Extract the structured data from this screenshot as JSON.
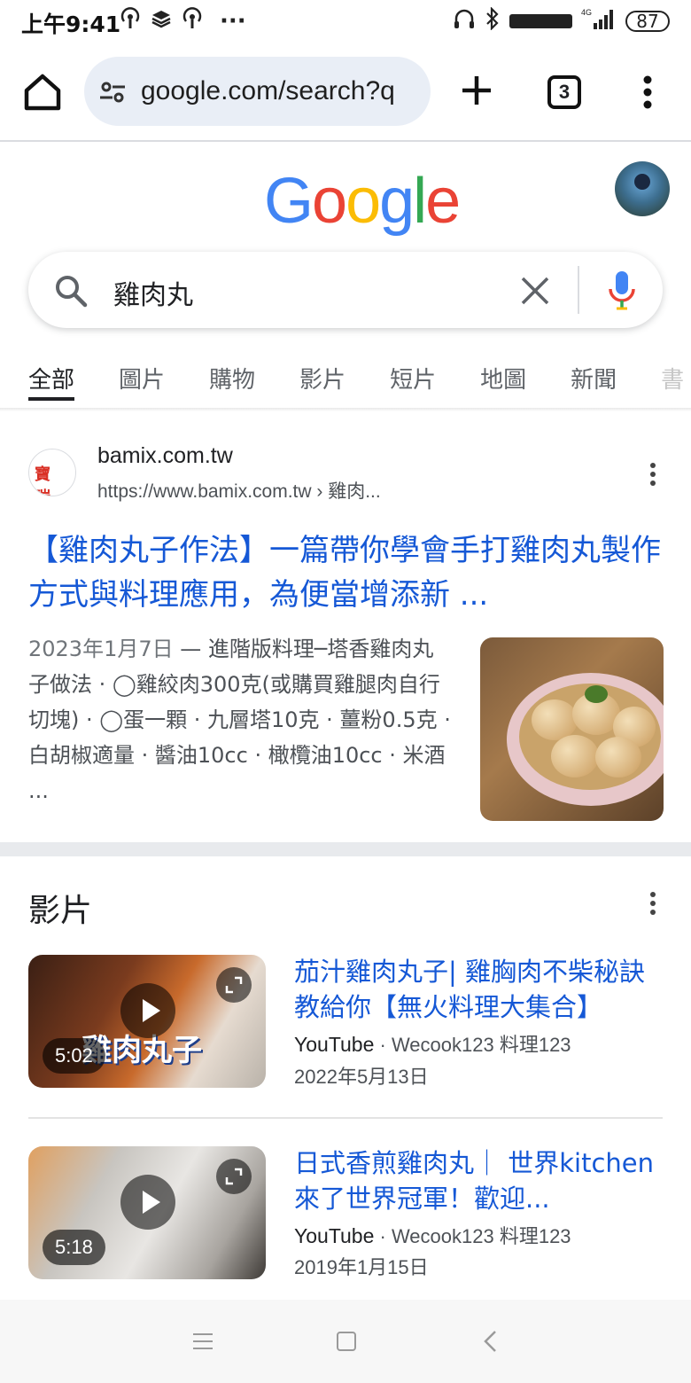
{
  "status_bar": {
    "time": "上午9:41",
    "more": "···",
    "network": "4G",
    "lte": "VoLTE",
    "battery": "87"
  },
  "toolbar": {
    "url": "google.com/search?q",
    "tab_count": "3"
  },
  "google": {
    "logo_letters": [
      "G",
      "o",
      "o",
      "g",
      "l",
      "e"
    ],
    "logo_colors": [
      "#4285F4",
      "#EA4335",
      "#FBBC05",
      "#4285F4",
      "#34A853",
      "#EA4335"
    ]
  },
  "search": {
    "query": "雞肉丸"
  },
  "tabs": [
    {
      "label": "全部"
    },
    {
      "label": "圖片"
    },
    {
      "label": "購物"
    },
    {
      "label": "影片"
    },
    {
      "label": "短片"
    },
    {
      "label": "地圖"
    },
    {
      "label": "新聞"
    },
    {
      "label": "書"
    }
  ],
  "result1": {
    "favicon_text": "寶 瑞",
    "site_name": "bamix.com.tw",
    "url": "https://www.bamix.com.tw › 雞肉...",
    "title": "【雞肉丸子作法】一篇帶你學會手打雞肉丸製作方式與料理應用，為便當增添新 ...",
    "date": "2023年1月7日",
    "snippet": " — 進階版料理─塔香雞肉丸子做法 · ◯雞絞肉300克(或購買雞腿肉自行切塊) · ◯蛋一顆 · 九層塔10克 · 薑粉0.5克 · 白胡椒適量 · 醬油10cc · 橄欖油10cc · 米酒 ..."
  },
  "videos": {
    "heading": "影片",
    "items": [
      {
        "title": "茄汁雞肉丸子| 雞胸肉不柴秘訣教給你【無火料理大集合】",
        "source": "YouTube",
        "channel": " · Wecook123 料理123",
        "date": "2022年5月13日",
        "duration": "5:02",
        "overlay": "雞肉丸子"
      },
      {
        "title": "日式香煎雞肉丸｜ 世界kitchen來了世界冠軍！歡迎...",
        "source": "YouTube",
        "channel": " · Wecook123 料理123",
        "date": "2019年1月15日",
        "duration": "5:18"
      }
    ]
  },
  "colors": {
    "link": "#1558d6",
    "accent_blue": "#4285F4"
  }
}
